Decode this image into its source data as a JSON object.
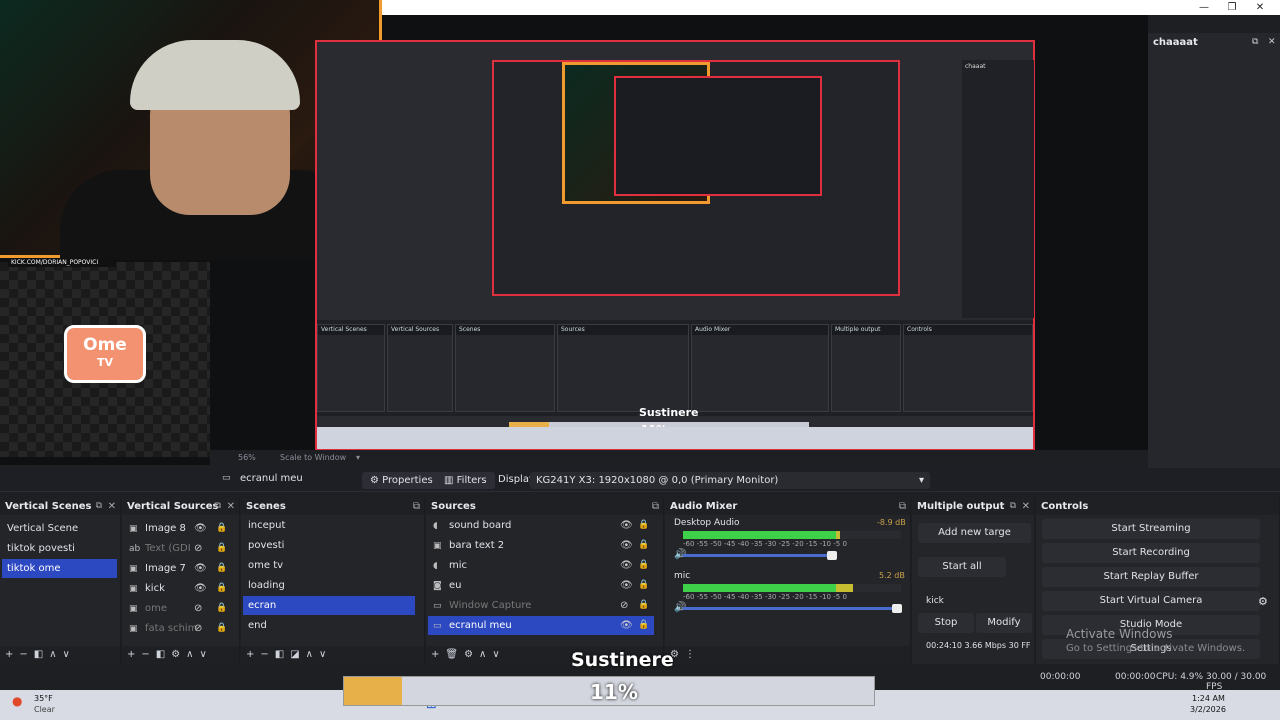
{
  "chat": {
    "title": "chaaaat"
  },
  "stream_overlay": {
    "kick_tag": "KICK.COM/DORIAN_POPOVICI",
    "ometv_line1": "Ome",
    "ometv_line2": "TV",
    "nested_sustinere": "Sustinere",
    "nested_pct": "11%"
  },
  "preview_bar": {
    "zoom": "56%",
    "mode": "Scale to Window"
  },
  "source_toolbar": {
    "current_source": "ecranul meu",
    "properties": "Properties",
    "filters": "Filters",
    "display_label": "Display",
    "display_value": "KG241Y X3: 1920x1080 @ 0,0 (Primary Monitor)"
  },
  "vertical_scenes": {
    "title": "Vertical Scenes",
    "items": [
      "Vertical Scene",
      "tiktok povesti",
      "tiktok ome"
    ]
  },
  "vertical_sources": {
    "title": "Vertical Sources",
    "items": [
      "Image 8",
      "Text (GDI",
      "Image 7",
      "kick",
      "ome",
      "fata schim"
    ]
  },
  "scenes": {
    "title": "Scenes",
    "items": [
      "inceput",
      "povesti",
      "ome tv",
      "loading",
      "ecran",
      "end"
    ]
  },
  "sources": {
    "title": "Sources",
    "items": [
      "sound board",
      "bara text 2",
      "mic",
      "eu",
      "Window Capture",
      "ecranul meu"
    ]
  },
  "audio_mixer": {
    "title": "Audio Mixer",
    "tracks": [
      {
        "name": "Desktop Audio",
        "db": "-8.9 dB",
        "level": 0.72
      },
      {
        "name": "mic",
        "db": "5.2 dB",
        "level": 0.78
      }
    ],
    "scale": "-60 -55 -50 -45 -40 -35 -30 -25 -20 -15 -10 -5 0"
  },
  "multiple_output": {
    "title": "Multiple output",
    "add": "Add new targe",
    "start_all": "Start all",
    "target": "kick",
    "stop": "Stop",
    "modify": "Modify",
    "stats": "00:24:10 3.66 Mbps 30 FF"
  },
  "controls": {
    "title": "Controls",
    "buttons": [
      "Start Streaming",
      "Start Recording",
      "Start Replay Buffer",
      "Start Virtual Camera",
      "Studio Mode",
      "Settings"
    ]
  },
  "watermark": {
    "line1": "Activate Windows",
    "line2": "Go to Settings to activate Windows."
  },
  "overlay": {
    "sustinere": "Sustinere",
    "progress_pct": "11%",
    "progress": 0.11
  },
  "status": {
    "live": "00:00:00",
    "rec": "00:00:00",
    "cpu": "CPU: 4.9%",
    "fps": "30.00 / 30.00 FPS"
  },
  "taskbar": {
    "temp": "35°F",
    "weather": "Clear",
    "search": "Search",
    "time": "1:24 AM",
    "date": "3/2/2026"
  }
}
